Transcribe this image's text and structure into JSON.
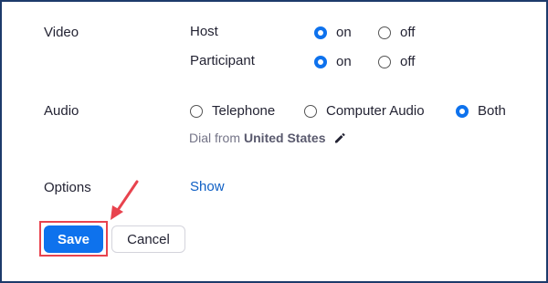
{
  "video": {
    "label": "Video",
    "host": {
      "label": "Host",
      "on": "on",
      "off": "off",
      "selected": "on"
    },
    "participant": {
      "label": "Participant",
      "on": "on",
      "off": "off",
      "selected": "on"
    }
  },
  "audio": {
    "label": "Audio",
    "options": [
      "Telephone",
      "Computer Audio",
      "Both"
    ],
    "selected": "Both",
    "dial_prefix": "Dial from",
    "dial_country": "United States"
  },
  "options": {
    "label": "Options",
    "show_link": "Show"
  },
  "buttons": {
    "save": "Save",
    "cancel": "Cancel"
  },
  "colors": {
    "accent": "#0e72ed",
    "highlight": "#e8434e",
    "frame": "#1d3a6b"
  },
  "icons": {
    "edit": "pencil-icon",
    "annotation": "red-arrow-icon"
  }
}
